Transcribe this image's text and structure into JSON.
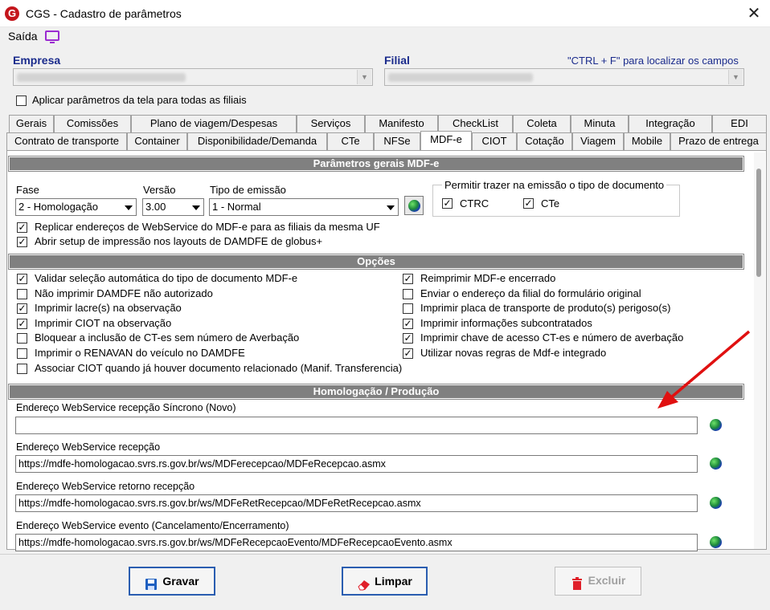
{
  "window": {
    "title": "CGS - Cadastro de parâmetros",
    "logo_letter": "G",
    "close_symbol": "✕"
  },
  "menu": {
    "saida_label": "Saída",
    "monitor_icon": "monitor-icon"
  },
  "header": {
    "empresa_label": "Empresa",
    "filial_label": "Filial",
    "ctrlf_hint": "\"CTRL + F\" para localizar os campos",
    "aplicar_label": "Aplicar parâmetros da tela para todas as filiais",
    "aplicar_checked": false
  },
  "tabs_row1": [
    "Gerais",
    "Comissões",
    "Plano de viagem/Despesas",
    "Serviços",
    "Manifesto",
    "CheckList",
    "Coleta",
    "Minuta",
    "Integração",
    "EDI"
  ],
  "tabs_row2": [
    "Contrato de transporte",
    "Container",
    "Disponibilidade/Demanda",
    "CTe",
    "NFSe",
    "MDF-e",
    "CIOT",
    "Cotação",
    "Viagem",
    "Mobile",
    "Prazo de entrega"
  ],
  "active_tab": "MDF-e",
  "section_gerais": {
    "title": "Parâmetros gerais MDF-e",
    "fase_label": "Fase",
    "fase_value": "2 - Homologação",
    "versao_label": "Versão",
    "versao_value": "3.00",
    "tipo_label": "Tipo de emissão",
    "tipo_value": "1 - Normal",
    "permitir_title": "Permitir trazer na emissão o tipo de documento",
    "ctrc_label": "CTRC",
    "cte_label": "CTe",
    "replicar_label": "Replicar endereços de WebService do MDF-e para as filiais da mesma UF",
    "abrir_label": "Abrir setup de impressão nos layouts de DAMDFE de globus+"
  },
  "section_opcoes": {
    "title": "Opções",
    "left": [
      {
        "label": "Validar seleção automática do tipo de documento MDF-e",
        "checked": true
      },
      {
        "label": "Não imprimir DAMDFE não autorizado",
        "checked": false
      },
      {
        "label": "Imprimir lacre(s) na observação",
        "checked": true
      },
      {
        "label": "Imprimir CIOT na observação",
        "checked": true
      },
      {
        "label": "Bloquear a inclusão de CT-es sem número de Averbação",
        "checked": false
      },
      {
        "label": "Imprimir o RENAVAN do veículo no DAMDFE",
        "checked": false
      },
      {
        "label": "Associar CIOT quando já houver documento relacionado (Manif. Transferencia)",
        "checked": false
      }
    ],
    "right": [
      {
        "label": "Reimprimir MDF-e encerrado",
        "checked": true
      },
      {
        "label": "Enviar o endereço da filial do formulário original",
        "checked": false
      },
      {
        "label": "Imprimir placa de transporte de produto(s) perigoso(s)",
        "checked": false
      },
      {
        "label": "Imprimir informações subcontratados",
        "checked": true
      },
      {
        "label": "Imprimir chave de acesso CT-es e número de averbação",
        "checked": true
      },
      {
        "label": "Utilizar novas regras de Mdf-e integrado",
        "checked": true
      }
    ]
  },
  "section_homolog": {
    "title": "Homologação / Produção",
    "fields": [
      {
        "label": "Endereço WebService recepção Síncrono (Novo)",
        "value": ""
      },
      {
        "label": "Endereço WebService recepção",
        "value": "https://mdfe-homologacao.svrs.rs.gov.br/ws/MDFerecepcao/MDFeRecepcao.asmx"
      },
      {
        "label": "Endereço WebService retorno recepção",
        "value": "https://mdfe-homologacao.svrs.rs.gov.br/ws/MDFeRetRecepcao/MDFeRetRecepcao.asmx"
      },
      {
        "label": "Endereço WebService evento (Cancelamento/Encerramento)",
        "value": "https://mdfe-homologacao.svrs.rs.gov.br/ws/MDFeRecepcaoEvento/MDFeRecepcaoEvento.asmx"
      }
    ]
  },
  "buttons": {
    "gravar": "Gravar",
    "limpar": "Limpar",
    "excluir": "Excluir"
  },
  "colors": {
    "accent_blue": "#1a2b8c",
    "section_gray": "#808080",
    "arrow_red": "#e01010",
    "logo_red": "#c4161c"
  }
}
